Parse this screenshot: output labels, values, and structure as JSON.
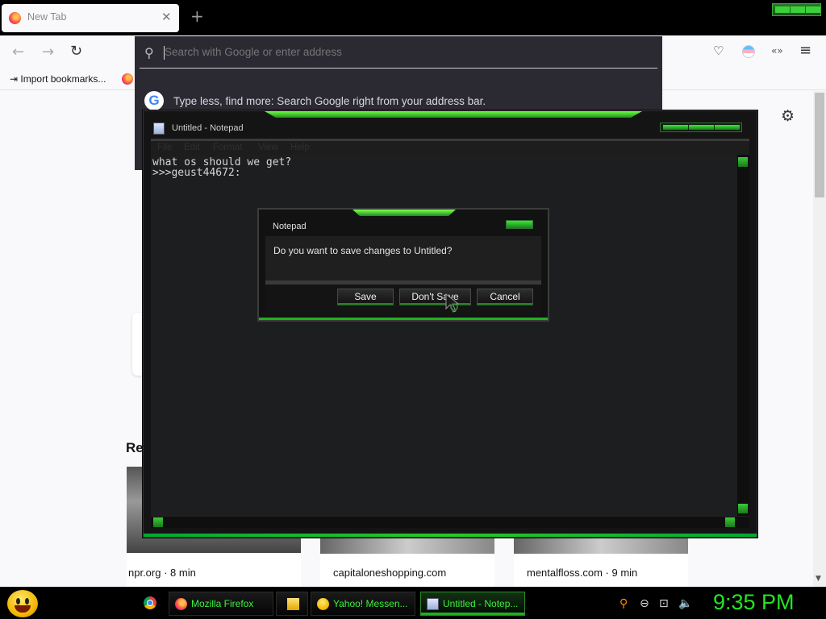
{
  "browser": {
    "tab_title": "New Tab",
    "tab_close": "✕",
    "new_tab": "+",
    "bookmarks_item": "Import bookmarks...",
    "url_placeholder": "Search with Google or enter address",
    "url_tip": "Type less, find more: Search Google right from your address bar.",
    "google_letter": "G",
    "nav": {
      "back": "←",
      "forward": "→",
      "reload": "↻",
      "pocket": "♡",
      "extension": "«»",
      "menu": "≡"
    }
  },
  "page": {
    "recommended_heading": "Re",
    "cards": [
      {
        "source": "npr.org · 8 min"
      },
      {
        "source": "capitaloneshopping.com"
      },
      {
        "source": "mentalfloss.com · 9 min"
      }
    ],
    "settings_icon": "⚙"
  },
  "notepad": {
    "title": "Untitled - Notepad",
    "menu": [
      "File",
      "Edit",
      "Format",
      "View",
      "Help"
    ],
    "content": "what os should we get?\n>>>geust44672:"
  },
  "dialog": {
    "title": "Notepad",
    "message": "Do you want to save changes to Untitled?",
    "buttons": {
      "save": "Save",
      "dont_save": "Don't Save",
      "cancel": "Cancel"
    }
  },
  "taskbar": {
    "items": [
      {
        "label": "Mozilla Firefox"
      },
      {
        "label": "Yahoo! Messen..."
      },
      {
        "label": "Untitled - Notep..."
      }
    ],
    "clock": "9:35 PM"
  },
  "colors": {
    "accent_green": "#22e622",
    "dark_bg": "#141414",
    "firefox_dark_panel": "#2b2a33"
  }
}
